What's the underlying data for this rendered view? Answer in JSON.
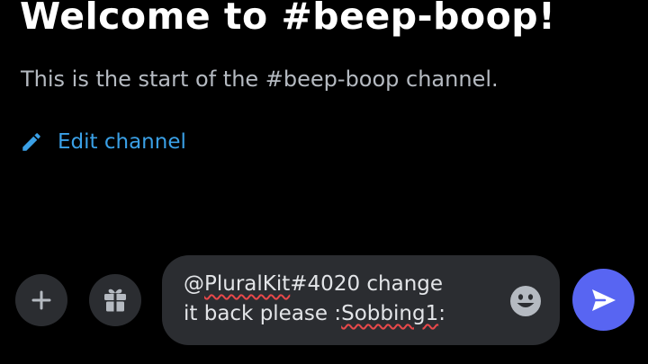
{
  "channel": {
    "welcome_title": "Welcome to #beep-boop!",
    "welcome_subtitle": "This is the start of the #beep-boop channel.",
    "edit_label": "Edit channel"
  },
  "composer": {
    "line1_prefix": "@",
    "line1_mention": "PluralKit",
    "line1_suffix": "#4020 change",
    "line2_prefix": "it back please :",
    "line2_emoji_name": "Sobbing1",
    "line2_suffix": ":"
  },
  "icons": {
    "edit": "pencil-icon",
    "add": "plus-icon",
    "gift": "gift-icon",
    "emoji": "smiley-icon",
    "send": "send-icon"
  },
  "colors": {
    "background": "#000000",
    "link": "#3aa0e6",
    "control_bg": "#2b2d31",
    "send_bg": "#5865f2",
    "spellcheck": "#e8484a"
  }
}
